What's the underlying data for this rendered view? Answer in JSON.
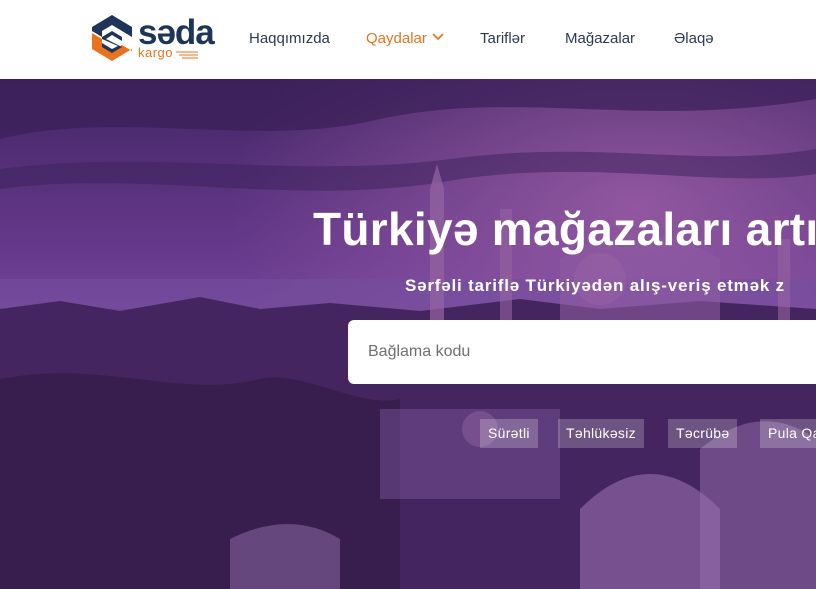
{
  "brand": {
    "name": "səda",
    "sub": "kargo",
    "colors": {
      "navy": "#1e3458",
      "orange": "#e8731c"
    }
  },
  "nav": {
    "items": [
      {
        "label": "Haqqımızda",
        "active": false
      },
      {
        "label": "Qaydalar",
        "active": true,
        "icon": "chevron-down-icon"
      },
      {
        "label": "Tariflər",
        "active": false
      },
      {
        "label": "Mağazalar",
        "active": false
      },
      {
        "label": "Əlaqə",
        "active": false
      }
    ]
  },
  "hero": {
    "title": "Türkiyə mağazaları artıq",
    "subtitle": "Sərfəli tariflə Türkiyədən alış-veriş etmək z",
    "search": {
      "placeholder": "Bağlama kodu",
      "value": ""
    },
    "tags": [
      "Sürətli",
      "Təhlükəsiz",
      "Təcrübə",
      "Pula Qa"
    ],
    "overlay_color": "#5b2d8c"
  }
}
